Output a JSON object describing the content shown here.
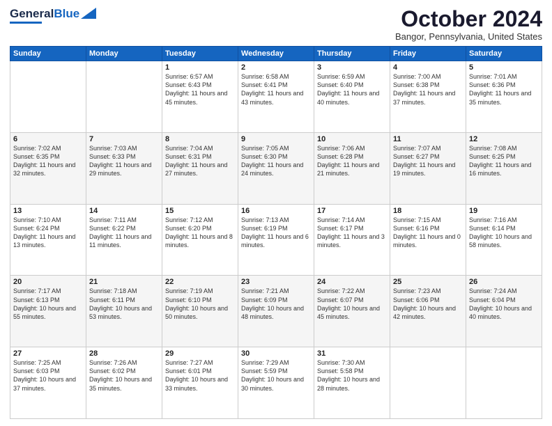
{
  "header": {
    "logo_general": "General",
    "logo_blue": "Blue",
    "month_title": "October 2024",
    "location": "Bangor, Pennsylvania, United States"
  },
  "days_of_week": [
    "Sunday",
    "Monday",
    "Tuesday",
    "Wednesday",
    "Thursday",
    "Friday",
    "Saturday"
  ],
  "weeks": [
    [
      {
        "day": "",
        "sunrise": "",
        "sunset": "",
        "daylight": ""
      },
      {
        "day": "",
        "sunrise": "",
        "sunset": "",
        "daylight": ""
      },
      {
        "day": "1",
        "sunrise": "Sunrise: 6:57 AM",
        "sunset": "Sunset: 6:43 PM",
        "daylight": "Daylight: 11 hours and 45 minutes."
      },
      {
        "day": "2",
        "sunrise": "Sunrise: 6:58 AM",
        "sunset": "Sunset: 6:41 PM",
        "daylight": "Daylight: 11 hours and 43 minutes."
      },
      {
        "day": "3",
        "sunrise": "Sunrise: 6:59 AM",
        "sunset": "Sunset: 6:40 PM",
        "daylight": "Daylight: 11 hours and 40 minutes."
      },
      {
        "day": "4",
        "sunrise": "Sunrise: 7:00 AM",
        "sunset": "Sunset: 6:38 PM",
        "daylight": "Daylight: 11 hours and 37 minutes."
      },
      {
        "day": "5",
        "sunrise": "Sunrise: 7:01 AM",
        "sunset": "Sunset: 6:36 PM",
        "daylight": "Daylight: 11 hours and 35 minutes."
      }
    ],
    [
      {
        "day": "6",
        "sunrise": "Sunrise: 7:02 AM",
        "sunset": "Sunset: 6:35 PM",
        "daylight": "Daylight: 11 hours and 32 minutes."
      },
      {
        "day": "7",
        "sunrise": "Sunrise: 7:03 AM",
        "sunset": "Sunset: 6:33 PM",
        "daylight": "Daylight: 11 hours and 29 minutes."
      },
      {
        "day": "8",
        "sunrise": "Sunrise: 7:04 AM",
        "sunset": "Sunset: 6:31 PM",
        "daylight": "Daylight: 11 hours and 27 minutes."
      },
      {
        "day": "9",
        "sunrise": "Sunrise: 7:05 AM",
        "sunset": "Sunset: 6:30 PM",
        "daylight": "Daylight: 11 hours and 24 minutes."
      },
      {
        "day": "10",
        "sunrise": "Sunrise: 7:06 AM",
        "sunset": "Sunset: 6:28 PM",
        "daylight": "Daylight: 11 hours and 21 minutes."
      },
      {
        "day": "11",
        "sunrise": "Sunrise: 7:07 AM",
        "sunset": "Sunset: 6:27 PM",
        "daylight": "Daylight: 11 hours and 19 minutes."
      },
      {
        "day": "12",
        "sunrise": "Sunrise: 7:08 AM",
        "sunset": "Sunset: 6:25 PM",
        "daylight": "Daylight: 11 hours and 16 minutes."
      }
    ],
    [
      {
        "day": "13",
        "sunrise": "Sunrise: 7:10 AM",
        "sunset": "Sunset: 6:24 PM",
        "daylight": "Daylight: 11 hours and 13 minutes."
      },
      {
        "day": "14",
        "sunrise": "Sunrise: 7:11 AM",
        "sunset": "Sunset: 6:22 PM",
        "daylight": "Daylight: 11 hours and 11 minutes."
      },
      {
        "day": "15",
        "sunrise": "Sunrise: 7:12 AM",
        "sunset": "Sunset: 6:20 PM",
        "daylight": "Daylight: 11 hours and 8 minutes."
      },
      {
        "day": "16",
        "sunrise": "Sunrise: 7:13 AM",
        "sunset": "Sunset: 6:19 PM",
        "daylight": "Daylight: 11 hours and 6 minutes."
      },
      {
        "day": "17",
        "sunrise": "Sunrise: 7:14 AM",
        "sunset": "Sunset: 6:17 PM",
        "daylight": "Daylight: 11 hours and 3 minutes."
      },
      {
        "day": "18",
        "sunrise": "Sunrise: 7:15 AM",
        "sunset": "Sunset: 6:16 PM",
        "daylight": "Daylight: 11 hours and 0 minutes."
      },
      {
        "day": "19",
        "sunrise": "Sunrise: 7:16 AM",
        "sunset": "Sunset: 6:14 PM",
        "daylight": "Daylight: 10 hours and 58 minutes."
      }
    ],
    [
      {
        "day": "20",
        "sunrise": "Sunrise: 7:17 AM",
        "sunset": "Sunset: 6:13 PM",
        "daylight": "Daylight: 10 hours and 55 minutes."
      },
      {
        "day": "21",
        "sunrise": "Sunrise: 7:18 AM",
        "sunset": "Sunset: 6:11 PM",
        "daylight": "Daylight: 10 hours and 53 minutes."
      },
      {
        "day": "22",
        "sunrise": "Sunrise: 7:19 AM",
        "sunset": "Sunset: 6:10 PM",
        "daylight": "Daylight: 10 hours and 50 minutes."
      },
      {
        "day": "23",
        "sunrise": "Sunrise: 7:21 AM",
        "sunset": "Sunset: 6:09 PM",
        "daylight": "Daylight: 10 hours and 48 minutes."
      },
      {
        "day": "24",
        "sunrise": "Sunrise: 7:22 AM",
        "sunset": "Sunset: 6:07 PM",
        "daylight": "Daylight: 10 hours and 45 minutes."
      },
      {
        "day": "25",
        "sunrise": "Sunrise: 7:23 AM",
        "sunset": "Sunset: 6:06 PM",
        "daylight": "Daylight: 10 hours and 42 minutes."
      },
      {
        "day": "26",
        "sunrise": "Sunrise: 7:24 AM",
        "sunset": "Sunset: 6:04 PM",
        "daylight": "Daylight: 10 hours and 40 minutes."
      }
    ],
    [
      {
        "day": "27",
        "sunrise": "Sunrise: 7:25 AM",
        "sunset": "Sunset: 6:03 PM",
        "daylight": "Daylight: 10 hours and 37 minutes."
      },
      {
        "day": "28",
        "sunrise": "Sunrise: 7:26 AM",
        "sunset": "Sunset: 6:02 PM",
        "daylight": "Daylight: 10 hours and 35 minutes."
      },
      {
        "day": "29",
        "sunrise": "Sunrise: 7:27 AM",
        "sunset": "Sunset: 6:01 PM",
        "daylight": "Daylight: 10 hours and 33 minutes."
      },
      {
        "day": "30",
        "sunrise": "Sunrise: 7:29 AM",
        "sunset": "Sunset: 5:59 PM",
        "daylight": "Daylight: 10 hours and 30 minutes."
      },
      {
        "day": "31",
        "sunrise": "Sunrise: 7:30 AM",
        "sunset": "Sunset: 5:58 PM",
        "daylight": "Daylight: 10 hours and 28 minutes."
      },
      {
        "day": "",
        "sunrise": "",
        "sunset": "",
        "daylight": ""
      },
      {
        "day": "",
        "sunrise": "",
        "sunset": "",
        "daylight": ""
      }
    ]
  ]
}
